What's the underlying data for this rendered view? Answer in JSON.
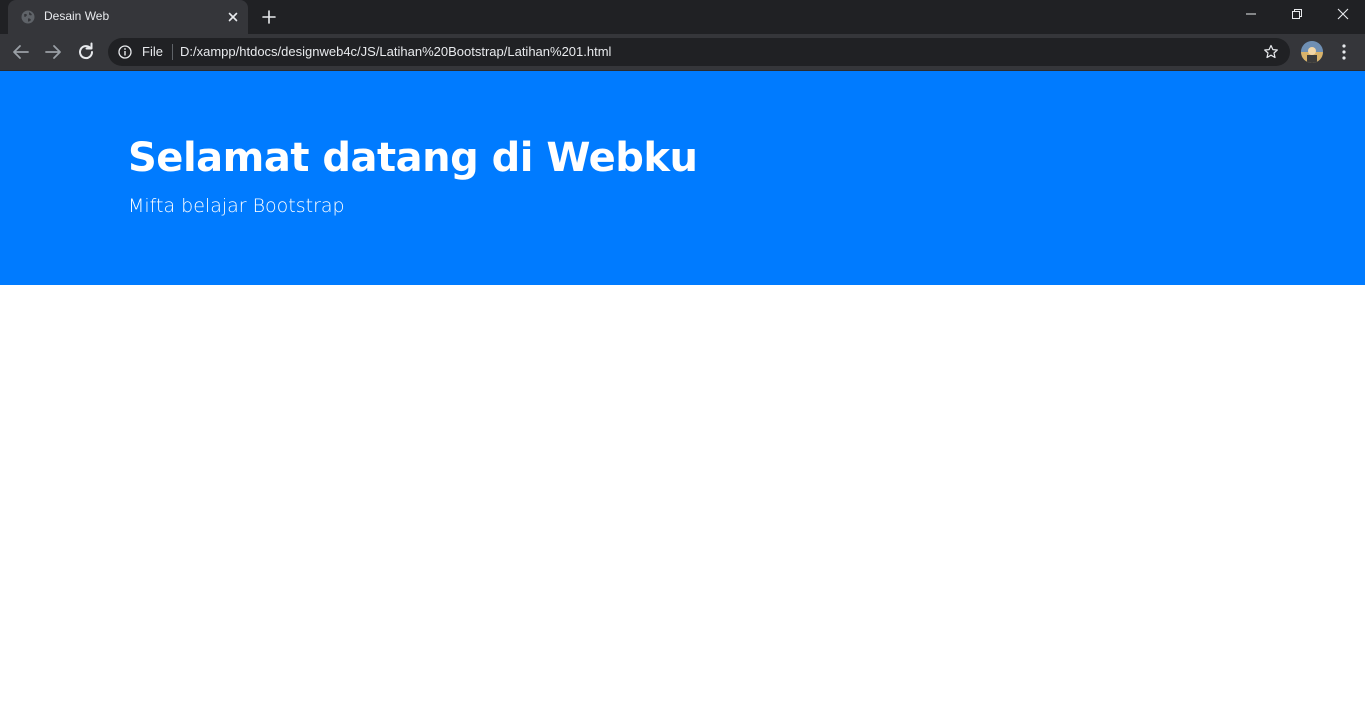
{
  "browser": {
    "tab": {
      "title": "Desain Web",
      "favicon": "globe-icon"
    },
    "address_bar": {
      "scheme_label": "File",
      "url": "D:/xampp/htdocs/designweb4c/JS/Latihan%20Bootstrap/Latihan%201.html"
    },
    "colors": {
      "frame": "#202124",
      "toolbar": "#35363a",
      "omnibox": "#202124",
      "text": "#e8eaed"
    }
  },
  "page": {
    "jumbotron": {
      "title": "Selamat datang di Webku",
      "lead": "Mifta belajar Bootstrap",
      "background": "#007bff",
      "text_color": "#ffffff"
    }
  }
}
